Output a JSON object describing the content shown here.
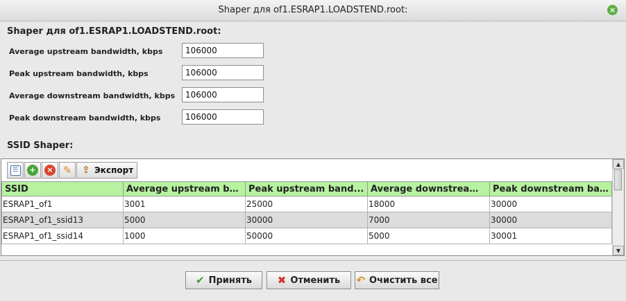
{
  "window": {
    "title": "Shaper для of1.ESRAP1.LOADSTEND.root:",
    "close_icon": "close-icon"
  },
  "header": {
    "title": "Shaper для of1.ESRAP1.LOADSTEND.root:"
  },
  "fields": [
    {
      "label": "Average upstream bandwidth, kbps",
      "value": "106000"
    },
    {
      "label": "Peak upstream bandwidth, kbps",
      "value": "106000"
    },
    {
      "label": "Average downstream bandwidth, kbps",
      "value": "106000"
    },
    {
      "label": "Peak downstream bandwidth, kbps",
      "value": "106000"
    }
  ],
  "ssid_section": {
    "title": "SSID Shaper:"
  },
  "toolbar": {
    "icons": [
      "list-icon",
      "add-icon",
      "delete-icon",
      "edit-icon",
      "export-icon"
    ],
    "export_label": "Экспорт"
  },
  "table": {
    "columns": [
      "SSID",
      "Average upstream ba...",
      "Peak upstream band...",
      "Average downstream ...",
      "Peak downstream ba..."
    ],
    "rows": [
      [
        "ESRAP1_of1",
        "3001",
        "25000",
        "18000",
        "30000"
      ],
      [
        "ESRAP1_of1_ssid13",
        "5000",
        "30000",
        "7000",
        "30000"
      ],
      [
        "ESRAP1_of1_ssid14",
        "1000",
        "50000",
        "5000",
        "30001"
      ]
    ]
  },
  "buttons": {
    "accept": "Принять",
    "cancel": "Отменить",
    "clear": "Очистить все"
  },
  "colors": {
    "header_bg": "#b6f2a0",
    "alt_row": "#dcdcdc",
    "close_green": "#5fae45"
  }
}
